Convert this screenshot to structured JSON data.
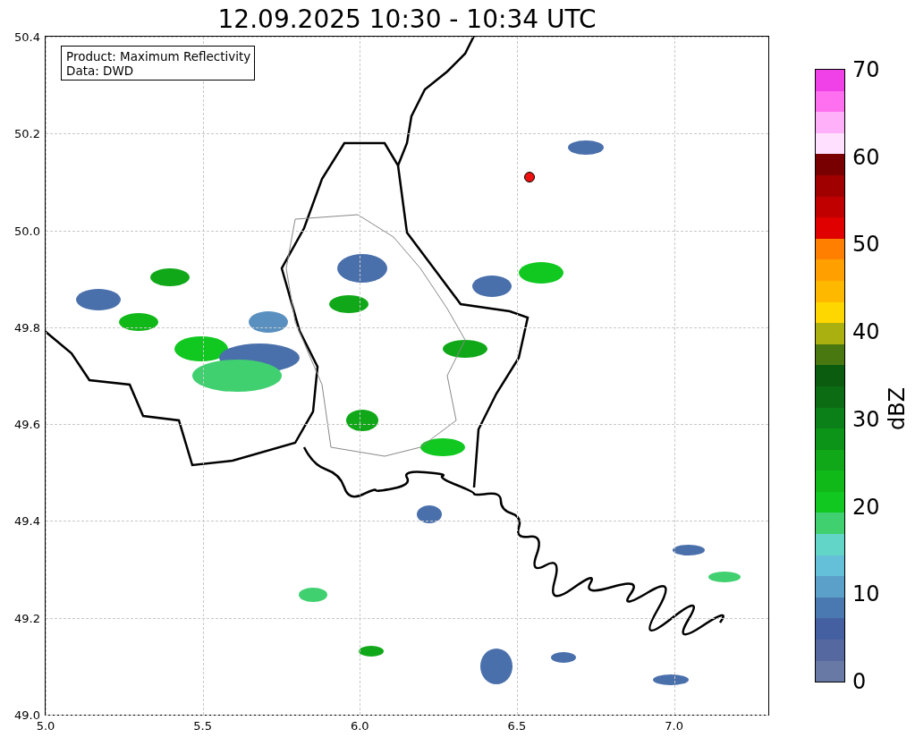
{
  "title": "12.09.2025 10:30 - 10:34 UTC",
  "legend": {
    "lines": [
      "Product: Maximum Reflectivity",
      "Data: DWD"
    ]
  },
  "chart_data": {
    "type": "scatter",
    "grid": true,
    "xlim": [
      5.0,
      7.3
    ],
    "ylim": [
      49.0,
      50.4
    ],
    "xticks": [
      {
        "value": 5.0,
        "label": "5.0"
      },
      {
        "value": 5.5,
        "label": "5.5"
      },
      {
        "value": 6.0,
        "label": "6.0"
      },
      {
        "value": 6.5,
        "label": "6.5"
      },
      {
        "value": 7.0,
        "label": "7.0"
      }
    ],
    "yticks": [
      {
        "value": 49.0,
        "label": "49.0"
      },
      {
        "value": 49.2,
        "label": "49.2"
      },
      {
        "value": 49.4,
        "label": "49.4"
      },
      {
        "value": 49.6,
        "label": "49.6"
      },
      {
        "value": 49.8,
        "label": "49.8"
      },
      {
        "value": 50.0,
        "label": "50.0"
      },
      {
        "value": 50.2,
        "label": "50.2"
      },
      {
        "value": 50.4,
        "label": "50.4"
      }
    ],
    "x": [
      6.54
    ],
    "series": [
      {
        "color": "#ee1111",
        "values": [
          50.11
        ]
      }
    ]
  },
  "colorbar": {
    "label": "dBZ",
    "ticks": [
      "70",
      "60",
      "50",
      "40",
      "30",
      "20",
      "10",
      "0"
    ],
    "bands": [
      {
        "color": "#f040e8"
      },
      {
        "color": "#ff70f0"
      },
      {
        "color": "#ffb0f8"
      },
      {
        "color": "#ffe0ff"
      },
      {
        "color": "#780000"
      },
      {
        "color": "#a00000"
      },
      {
        "color": "#c00000"
      },
      {
        "color": "#e00000"
      },
      {
        "color": "#ff8000"
      },
      {
        "color": "#ffa000"
      },
      {
        "color": "#ffb800"
      },
      {
        "color": "#ffd700"
      },
      {
        "color": "#aab010"
      },
      {
        "color": "#4a7810"
      },
      {
        "color": "#0c5c10"
      },
      {
        "color": "#0c6c14"
      },
      {
        "color": "#0c8018"
      },
      {
        "color": "#0c9418"
      },
      {
        "color": "#10a818"
      },
      {
        "color": "#10b818"
      },
      {
        "color": "#10c820"
      },
      {
        "color": "#40d070"
      },
      {
        "color": "#63d4c8"
      },
      {
        "color": "#63c0d8"
      },
      {
        "color": "#5aa0c8"
      },
      {
        "color": "#4a78b0"
      },
      {
        "color": "#4560a0"
      },
      {
        "color": "#5668a0"
      },
      {
        "color": "#6979a6"
      }
    ]
  }
}
